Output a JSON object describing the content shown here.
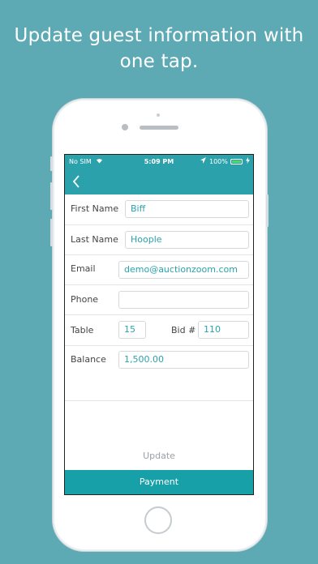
{
  "headline": "Update guest information with one tap.",
  "status": {
    "carrier": "No SIM",
    "time": "5:09 PM",
    "battery": "100%"
  },
  "form": {
    "first_name_label": "First Name",
    "first_name_value": "Biff",
    "last_name_label": "Last Name",
    "last_name_value": "Hoople",
    "email_label": "Email",
    "email_value": "demo@auctionzoom.com",
    "phone_label": "Phone",
    "phone_value": "",
    "table_label": "Table",
    "table_value": "15",
    "bid_label": "Bid #",
    "bid_value": "110",
    "balance_label": "Balance",
    "balance_value": "1,500.00"
  },
  "actions": {
    "update_label": "Update",
    "payment_label": "Payment"
  },
  "colors": {
    "background": "#5eaab4",
    "accent": "#2ba2ab",
    "payment_bar": "#17a0a8"
  },
  "icons": [
    "back-chevron-icon",
    "wifi-icon",
    "location-arrow-icon",
    "battery-icon",
    "charging-bolt-icon"
  ]
}
